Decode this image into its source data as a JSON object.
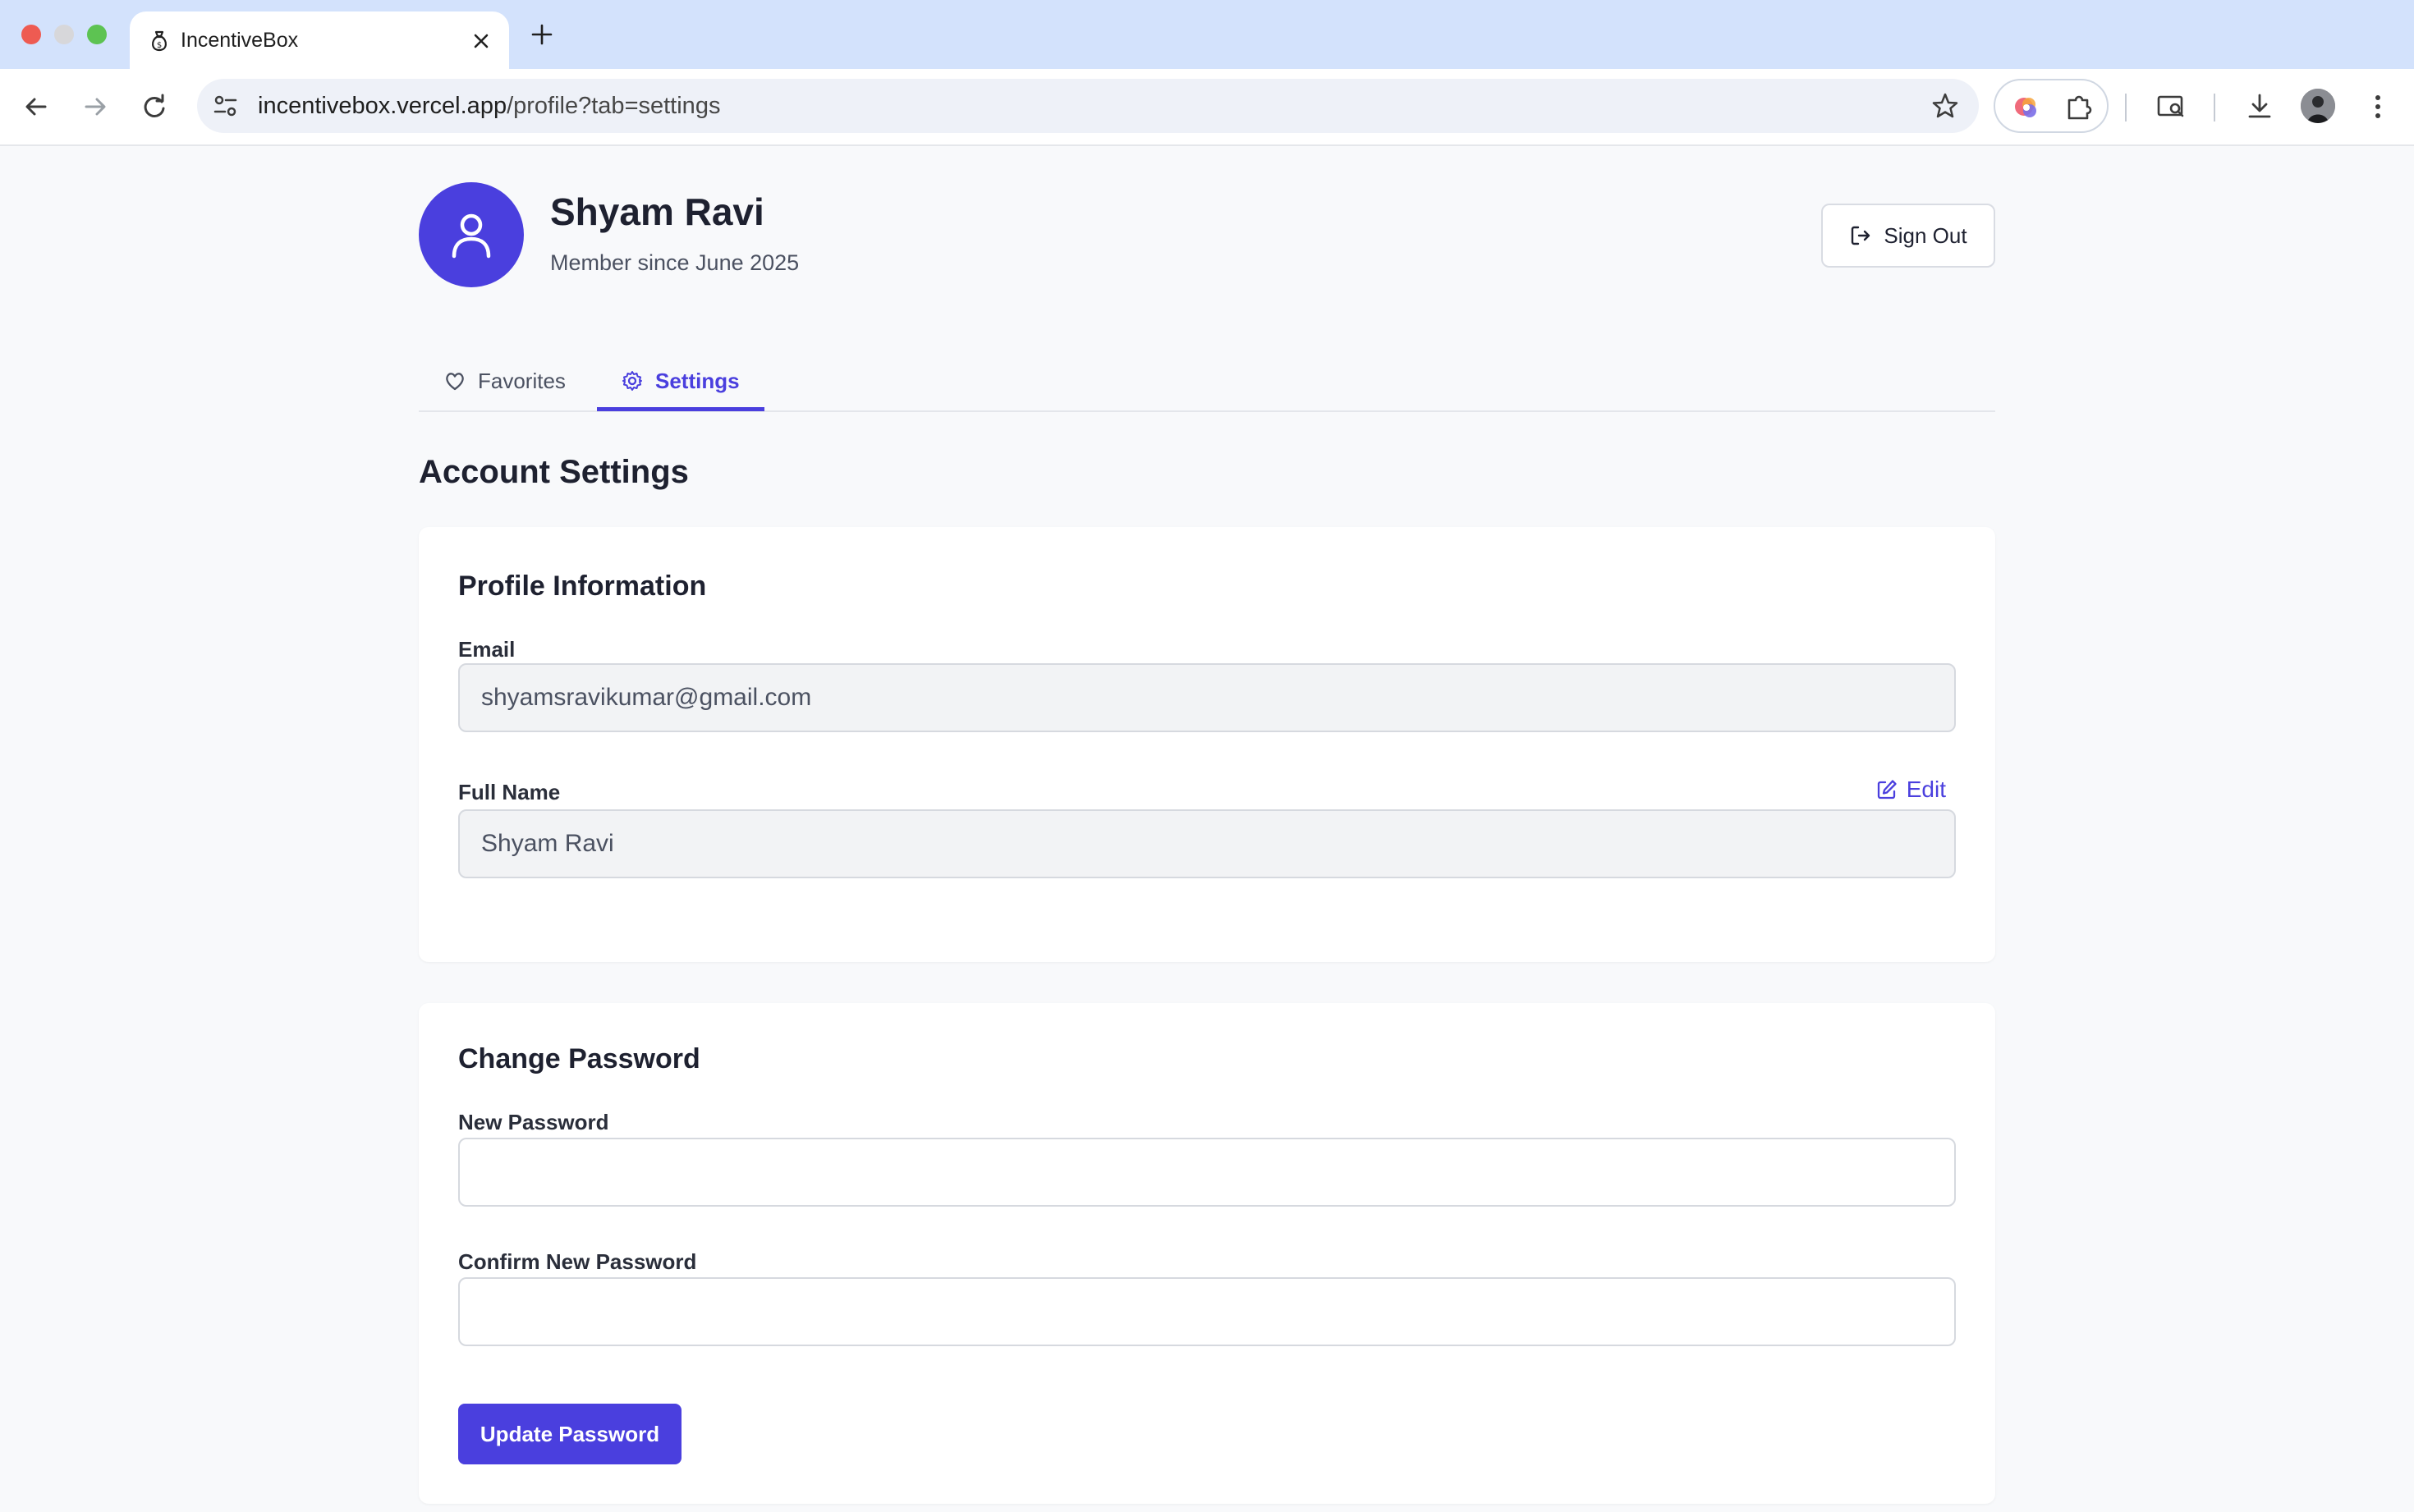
{
  "browser": {
    "tab_title": "IncentiveBox",
    "url_host": "incentivebox.vercel.app",
    "url_path": "/profile?tab=settings"
  },
  "profile": {
    "name": "Shyam Ravi",
    "member_since": "Member since June 2025",
    "sign_out_label": "Sign Out"
  },
  "tabs": [
    {
      "label": "Favorites",
      "icon": "heart-icon",
      "active": false
    },
    {
      "label": "Settings",
      "icon": "gear-icon",
      "active": true
    }
  ],
  "settings": {
    "title": "Account Settings",
    "profile_info": {
      "title": "Profile Information",
      "email_label": "Email",
      "email_value": "shyamsravikumar@gmail.com",
      "full_name_label": "Full Name",
      "full_name_value": "Shyam Ravi",
      "edit_label": "Edit"
    },
    "change_password": {
      "title": "Change Password",
      "new_password_label": "New Password",
      "confirm_password_label": "Confirm New Password",
      "button_label": "Update Password"
    }
  },
  "colors": {
    "accent": "#4a3fde",
    "page_bg": "#f8f9fb",
    "chrome_bg": "#d3e2fc"
  }
}
